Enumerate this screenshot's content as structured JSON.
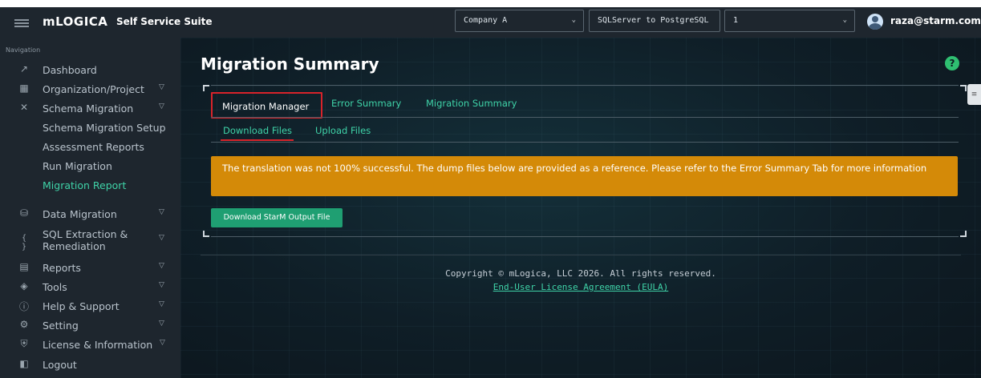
{
  "header": {
    "logo": "mLOGICA",
    "suite": "Self Service Suite",
    "company_select": "Company A",
    "migration_select": "SQLServer to PostgreSQL",
    "project_select": "1",
    "user": "raza@starm.com"
  },
  "sidebar": {
    "title": "Navigation",
    "items": [
      {
        "label": "Dashboard",
        "icon": "chart-line-icon"
      },
      {
        "label": "Organization/Project",
        "icon": "grid-icon"
      },
      {
        "label": "Schema Migration",
        "icon": "tools-icon"
      },
      {
        "label": "Schema Migration Setup"
      },
      {
        "label": "Assessment Reports"
      },
      {
        "label": "Run Migration"
      },
      {
        "label": "Migration Report"
      },
      {
        "label": "Data Migration",
        "icon": "database-icon"
      },
      {
        "label": "SQL Extraction &",
        "label2": "Remediation",
        "icon": "braces-icon"
      },
      {
        "label": "Reports",
        "icon": "report-icon"
      },
      {
        "label": "Tools",
        "icon": "layers-icon"
      },
      {
        "label": "Help & Support",
        "icon": "help-circle-icon"
      },
      {
        "label": "Setting",
        "icon": "gear-icon"
      },
      {
        "label": "License & Information",
        "icon": "shield-icon"
      },
      {
        "label": "Logout",
        "icon": "logout-icon"
      }
    ]
  },
  "main": {
    "title": "Migration Summary",
    "help": "?",
    "tabs": [
      "Migration Manager",
      "Error Summary",
      "Migration Summary"
    ],
    "subtabs": [
      "Download Files",
      "Upload Files"
    ],
    "warning": "The translation was not 100% successful. The dump files below are provided as a reference. Please refer to the Error Summary Tab for more information",
    "download_button": "Download StarM Output File",
    "copyright": "Copyright © mLogica, LLC 2026. All rights reserved.",
    "eula": "End-User License Agreement (EULA)"
  },
  "colors": {
    "accent": "#3fd3a8",
    "warning": "#d48a08",
    "button": "#1f9f72",
    "highlight": "#d8232a"
  }
}
